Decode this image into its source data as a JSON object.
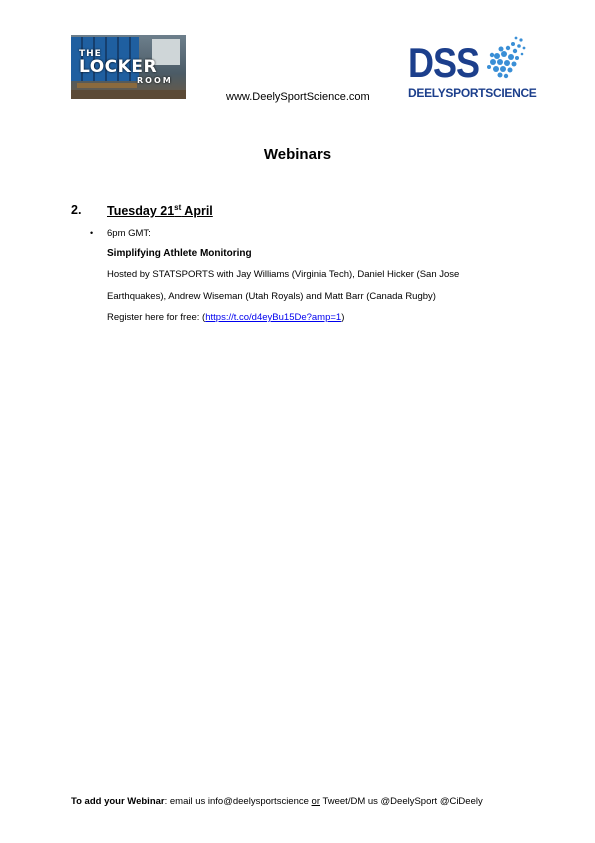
{
  "header": {
    "locker_logo": {
      "the": "THE",
      "main": "LOCKER",
      "room": "ROOM"
    },
    "website": "www.DeelySportScience.com",
    "dss_logo": {
      "letters": "DSS",
      "sub_a": "DEELY",
      "sub_b": "SPORT",
      "sub_c": "SCIENCE"
    }
  },
  "page": {
    "title": "Webinars"
  },
  "item": {
    "number": "2.",
    "date_prefix": "Tuesday 21",
    "date_sup": "st",
    "date_suffix": " April",
    "bullet": "•",
    "time": "6pm GMT:",
    "title": "Simplifying Athlete Monitoring",
    "host_line1": "Hosted by STATSPORTS with Jay Williams (Virginia Tech), Daniel Hicker (San Jose",
    "host_line2": "Earthquakes), Andrew Wiseman (Utah Royals) and Matt Barr (Canada Rugby)",
    "register_prefix": "Register here for free: (",
    "register_link": "https://t.co/d4eyBu15De?amp=1",
    "register_suffix": ")"
  },
  "footer": {
    "bold": "To add your Webinar",
    "text1": ": email us info@deelysportscience ",
    "or": "or",
    "text2": " Tweet/DM us @DeelySport @CiDeely"
  },
  "colors": {
    "brand_blue": "#1c3f8c",
    "globe_blue": "#3a8fd6",
    "link": "#0000ee"
  }
}
